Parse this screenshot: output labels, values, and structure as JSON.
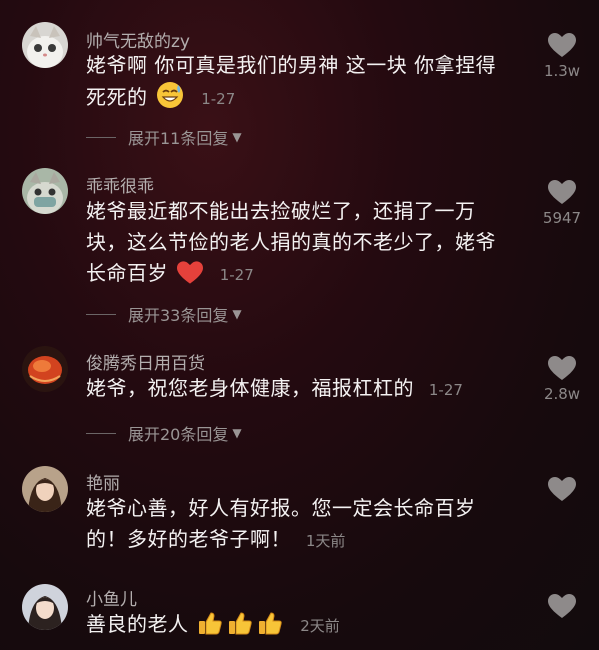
{
  "comments": [
    {
      "author": "帅气无敌的zy",
      "text_lines": [
        "姥爷啊 你可真是我们的男神 这一块 你拿捏得",
        "死死的"
      ],
      "time": "1-27",
      "likes": "1.3w",
      "replies": "展开11条回复",
      "emoji": "grin-sweat-emoji"
    },
    {
      "author": "乖乖很乖",
      "text_lines": [
        "姥爷最近都不能出去捡破烂了，还捐了一万",
        "块，这么节俭的老人捐的真的不老少了，姥爷",
        "长命百岁"
      ],
      "time": "1-27",
      "likes": "5947",
      "replies": "展开33条回复",
      "emoji": "red-heart-emoji"
    },
    {
      "author": "俊腾秀日用百货",
      "text_lines": [
        "姥爷，祝您老身体健康，福报杠杠的"
      ],
      "time": "1-27",
      "likes": "2.8w",
      "replies": "展开20条回复"
    },
    {
      "author": "艳丽",
      "text_lines": [
        "姥爷心善，好人有好报。您一定会长命百岁",
        "的！多好的老爷子啊！"
      ],
      "time": "1天前",
      "likes": ""
    },
    {
      "author": "小鱼儿",
      "text_lines": [
        "善良的老人"
      ],
      "time": "2天前",
      "likes": "",
      "emoji": "thumbs-up-emoji"
    }
  ],
  "colors": {
    "background": "#1a0b0f",
    "text": "#f4f2f2",
    "muted": "#8c8888",
    "heart": "#e5413b"
  }
}
